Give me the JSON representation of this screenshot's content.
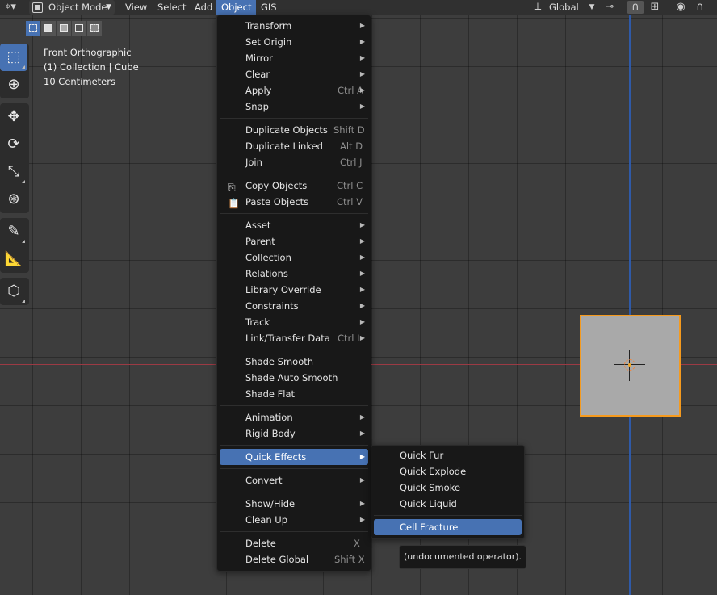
{
  "header": {
    "mode_label": "Object Mode",
    "menus": [
      "View",
      "Select",
      "Add",
      "Object",
      "GIS"
    ],
    "orientation_label": "Global"
  },
  "viewport_info": {
    "view_name": "Front Orthographic",
    "collection": "(1) Collection | Cube",
    "scale": "10 Centimeters"
  },
  "object_menu": {
    "items": [
      {
        "label": "Transform",
        "submenu": true
      },
      {
        "label": "Set Origin",
        "submenu": true
      },
      {
        "label": "Mirror",
        "submenu": true
      },
      {
        "label": "Clear",
        "submenu": true
      },
      {
        "label": "Apply",
        "shortcut": "Ctrl A",
        "submenu": true
      },
      {
        "label": "Snap",
        "submenu": true
      },
      {
        "label": "Duplicate Objects",
        "shortcut": "Shift D"
      },
      {
        "label": "Duplicate Linked",
        "shortcut": "Alt D"
      },
      {
        "label": "Join",
        "shortcut": "Ctrl J"
      },
      {
        "label": "Copy Objects",
        "shortcut": "Ctrl C"
      },
      {
        "label": "Paste Objects",
        "shortcut": "Ctrl V"
      },
      {
        "label": "Asset",
        "submenu": true
      },
      {
        "label": "Parent",
        "submenu": true
      },
      {
        "label": "Collection",
        "submenu": true
      },
      {
        "label": "Relations",
        "submenu": true
      },
      {
        "label": "Library Override",
        "submenu": true
      },
      {
        "label": "Constraints",
        "submenu": true
      },
      {
        "label": "Track",
        "submenu": true
      },
      {
        "label": "Link/Transfer Data",
        "shortcut": "Ctrl L",
        "submenu": true
      },
      {
        "label": "Shade Smooth"
      },
      {
        "label": "Shade Auto Smooth"
      },
      {
        "label": "Shade Flat"
      },
      {
        "label": "Animation",
        "submenu": true
      },
      {
        "label": "Rigid Body",
        "submenu": true
      },
      {
        "label": "Quick Effects",
        "submenu": true,
        "highlighted": true
      },
      {
        "label": "Convert",
        "submenu": true
      },
      {
        "label": "Show/Hide",
        "submenu": true
      },
      {
        "label": "Clean Up",
        "submenu": true
      },
      {
        "label": "Delete",
        "shortcut": "X"
      },
      {
        "label": "Delete Global",
        "shortcut": "Shift X"
      }
    ]
  },
  "quick_effects_menu": {
    "items": [
      {
        "label": "Quick Fur"
      },
      {
        "label": "Quick Explode"
      },
      {
        "label": "Quick Smoke"
      },
      {
        "label": "Quick Liquid"
      },
      {
        "label": "Cell Fracture",
        "highlighted": true
      }
    ]
  },
  "tooltip": "(undocumented operator).",
  "colors": {
    "accent": "#4772b3",
    "selection_outline": "#f59a1e",
    "x_axis": "#9c3a44",
    "z_axis": "#2f5aa8"
  }
}
